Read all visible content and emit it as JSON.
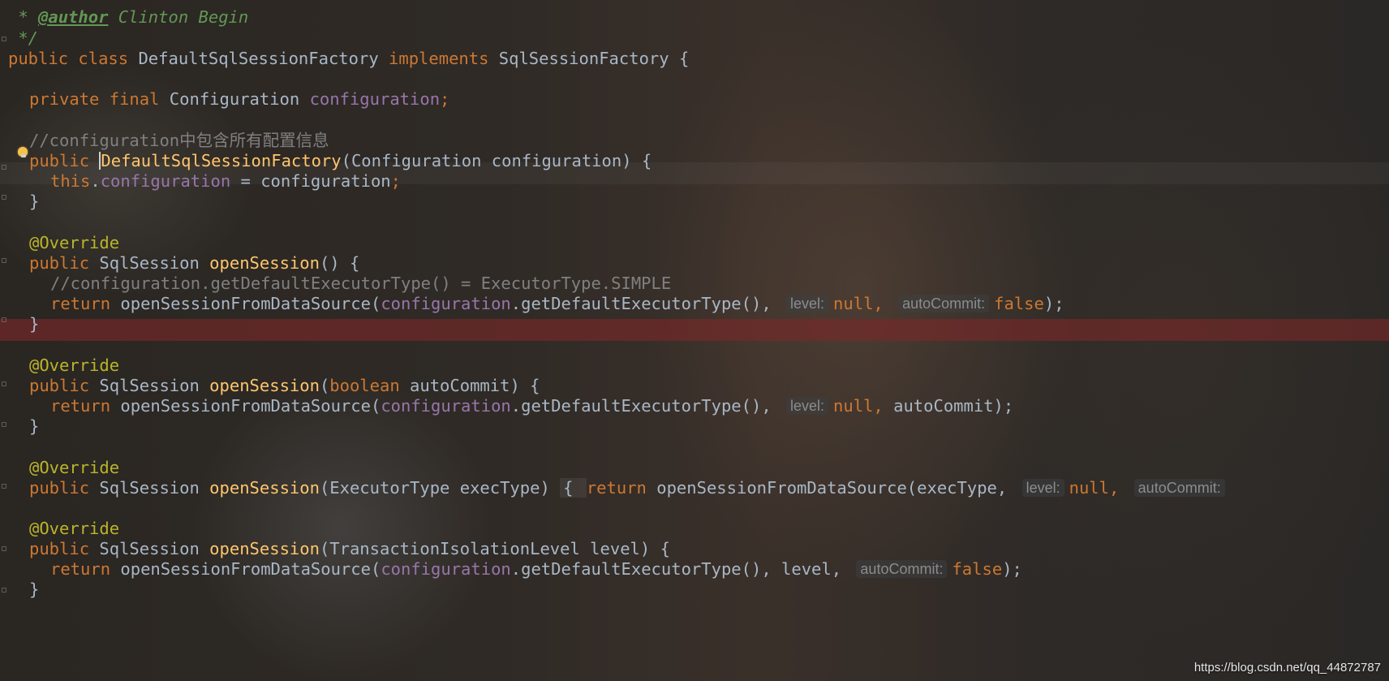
{
  "editor": {
    "language": "java",
    "lines": {
      "author_star": " * ",
      "author_tag": "@author",
      "author_name": " Clinton Begin",
      "doc_end": " */",
      "class_public": "public class ",
      "class_name": "DefaultSqlSessionFactory ",
      "class_implements": "implements ",
      "class_iface": "SqlSessionFactory {",
      "field_mods": "private final ",
      "field_type": "Configuration ",
      "field_name": "configuration",
      "field_semi": ";",
      "ctor_comment": "//configuration中包含所有配置信息",
      "ctor_public": "public ",
      "ctor_name": "DefaultSqlSessionFactory",
      "ctor_params": "(Configuration configuration) {",
      "assign_this": "this",
      "assign_dot": ".",
      "assign_field": "configuration",
      "assign_rest": " = configuration",
      "assign_semi": ";",
      "close_brace": "}",
      "override": "@Override",
      "m1_public": "public ",
      "m1_type": "SqlSession ",
      "m1_name": "openSession",
      "m1_params": "() {",
      "m1_comment": "//configuration.getDefaultExecutorType() = ExecutorType.SIMPLE",
      "return_kw": "return ",
      "call_name": "openSessionFromDataSource(",
      "call_cfg": "configuration",
      "call_get": ".getDefaultExecutorType(), ",
      "hint_level": "level:",
      "null_kw": "null",
      "comma": ", ",
      "hint_autocommit": "autoCommit:",
      "false_kw": "false",
      "call_end": ");",
      "m2_params_open": "(",
      "m2_boolean": "boolean ",
      "m2_params_rest": "autoCommit) {",
      "m2_autocommit": "autoCommit",
      "m3_params": "(ExecutorType execType) ",
      "m3_brace": "{ ",
      "m3_call_args": "execType, ",
      "m4_params": "(TransactionIsolationLevel level) {",
      "m4_level": "level, "
    }
  },
  "watermark": "https://blog.csdn.net/qq_44872787"
}
